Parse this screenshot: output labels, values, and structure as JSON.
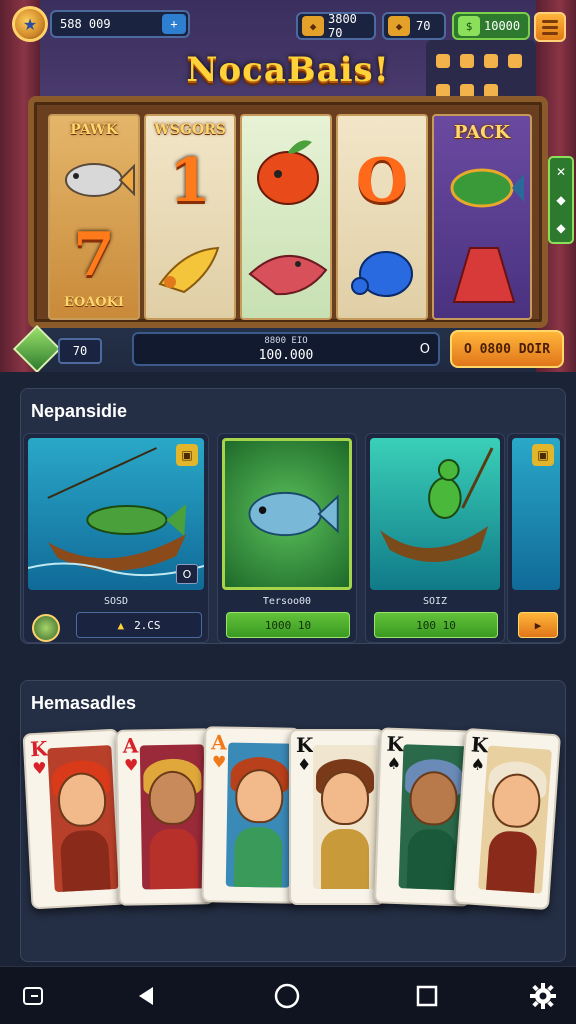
{
  "header": {
    "player_value": "588 009",
    "resource1": "3800 70",
    "resource2": "70",
    "resource3": "10000",
    "add_icon": "plus-icon",
    "menu_icon": "hamburger-icon"
  },
  "logo": {
    "text": "NocaBais!"
  },
  "reels": {
    "labels": [
      "PAWK",
      "WSGORS",
      "",
      "",
      "PACK"
    ],
    "r0_bottom": "EOAOKI",
    "r0_symbol": "7",
    "r1_symbol": "1",
    "r3_symbol": "O"
  },
  "side_panel": {
    "icons": [
      "✕",
      "◆",
      "◆"
    ]
  },
  "slot_bar": {
    "bet_value": "70",
    "win_label": "8800 EIO",
    "win_value": "100.000",
    "win_suffix": "O",
    "spin_label": "O 0800 DOIR"
  },
  "section1": {
    "title": "Nepansidie",
    "cards": [
      {
        "caption": "SOSD",
        "button": "2.CS",
        "corner": "O"
      },
      {
        "caption": "Tersoo00",
        "button": "1000 10"
      },
      {
        "caption": "SOIZ",
        "button": "100 10"
      }
    ],
    "play_icon": "play-icon"
  },
  "section2": {
    "title": "Hemasadles",
    "cards": [
      {
        "rank": "K",
        "suit": "♥",
        "color": "red"
      },
      {
        "rank": "A",
        "suit": "♥",
        "color": "red"
      },
      {
        "rank": "A",
        "suit": "♥",
        "color": "orange"
      },
      {
        "rank": "K",
        "suit": "♦",
        "color": "black"
      },
      {
        "rank": "K",
        "suit": "♠",
        "color": "black"
      },
      {
        "rank": "K",
        "suit": "♠",
        "color": "black"
      }
    ]
  },
  "navbar": {
    "icons": [
      "back-app-icon",
      "triangle-back-icon",
      "home-circle-icon",
      "recents-square-icon",
      "settings-gear-icon"
    ]
  },
  "colors": {
    "accent_orange": "#ffb53a",
    "accent_green": "#62c23a",
    "panel_bg": "#242e44"
  }
}
